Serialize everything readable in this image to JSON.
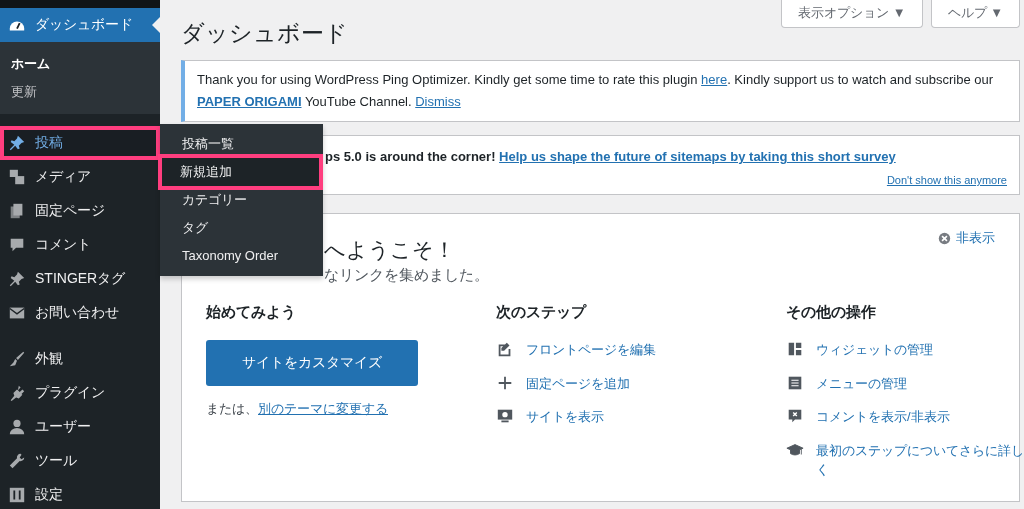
{
  "sidebar": {
    "items": [
      {
        "label": "ダッシュボード",
        "selected": true,
        "highlighted": false,
        "children": [
          {
            "label": "ホーム",
            "selected": true
          },
          {
            "label": "更新",
            "selected": false
          }
        ]
      },
      {
        "label": "投稿",
        "selected": false,
        "highlighted": true
      },
      {
        "label": "メディア",
        "selected": false,
        "highlighted": false
      },
      {
        "label": "固定ページ",
        "selected": false,
        "highlighted": false
      },
      {
        "label": "コメント",
        "selected": false,
        "highlighted": false
      },
      {
        "label": "STINGERタグ",
        "selected": false,
        "highlighted": false
      },
      {
        "label": "お問い合わせ",
        "selected": false,
        "highlighted": false
      },
      {
        "label": "外観",
        "selected": false,
        "highlighted": false
      },
      {
        "label": "プラグイン",
        "selected": false,
        "highlighted": false
      },
      {
        "label": "ユーザー",
        "selected": false,
        "highlighted": false
      },
      {
        "label": "ツール",
        "selected": false,
        "highlighted": false
      },
      {
        "label": "設定",
        "selected": false,
        "highlighted": false
      }
    ]
  },
  "flyout": {
    "items": [
      {
        "label": "投稿一覧",
        "highlighted": false
      },
      {
        "label": "新規追加",
        "highlighted": true
      },
      {
        "label": "カテゴリー",
        "highlighted": false
      },
      {
        "label": "タグ",
        "highlighted": false
      },
      {
        "label": "Taxonomy Order",
        "highlighted": false
      }
    ]
  },
  "header_buttons": [
    "表示オプション ▼",
    "ヘルプ ▼"
  ],
  "title": "ダッシュボード",
  "notices": [
    {
      "segments": [
        {
          "kind": "text",
          "text": "Thank you for using WordPress Ping Optimizer. Kindly get some time to rate this plugin "
        },
        {
          "kind": "link",
          "text": "here"
        },
        {
          "kind": "text",
          "text": ". Kindly support us to watch and subscribe our "
        },
        {
          "kind": "link",
          "text": "**PAPER ORIGAMI**"
        },
        {
          "kind": "text",
          "text": " YouTube Channel. "
        },
        {
          "kind": "link",
          "text": "Dismiss"
        }
      ]
    },
    {
      "segments": [
        {
          "kind": "text",
          "text": "ps 5.0 is around the corner! "
        },
        {
          "kind": "link",
          "text": "Help us shape the future of sitemaps by taking this short survey"
        }
      ],
      "footer_link": "Don't show this anymore"
    }
  ],
  "welcome": {
    "title": "へようこそ！",
    "subtitle": "なリンクを集めました。",
    "dismiss": "非表示",
    "columns": [
      {
        "heading": "始めてみよう",
        "kind": "start",
        "button": "サイトをカスタマイズ",
        "prefix": "または、",
        "link": "別のテーマに変更する"
      },
      {
        "heading": "次のステップ",
        "kind": "links",
        "links": [
          "フロントページを編集",
          "固定ページを追加",
          "サイトを表示"
        ]
      },
      {
        "heading": "その他の操作",
        "kind": "links",
        "links": [
          "ウィジェットの管理",
          "メニューの管理",
          "コメントを表示/非表示",
          "最初のステップについてさらに詳しく"
        ]
      }
    ]
  }
}
